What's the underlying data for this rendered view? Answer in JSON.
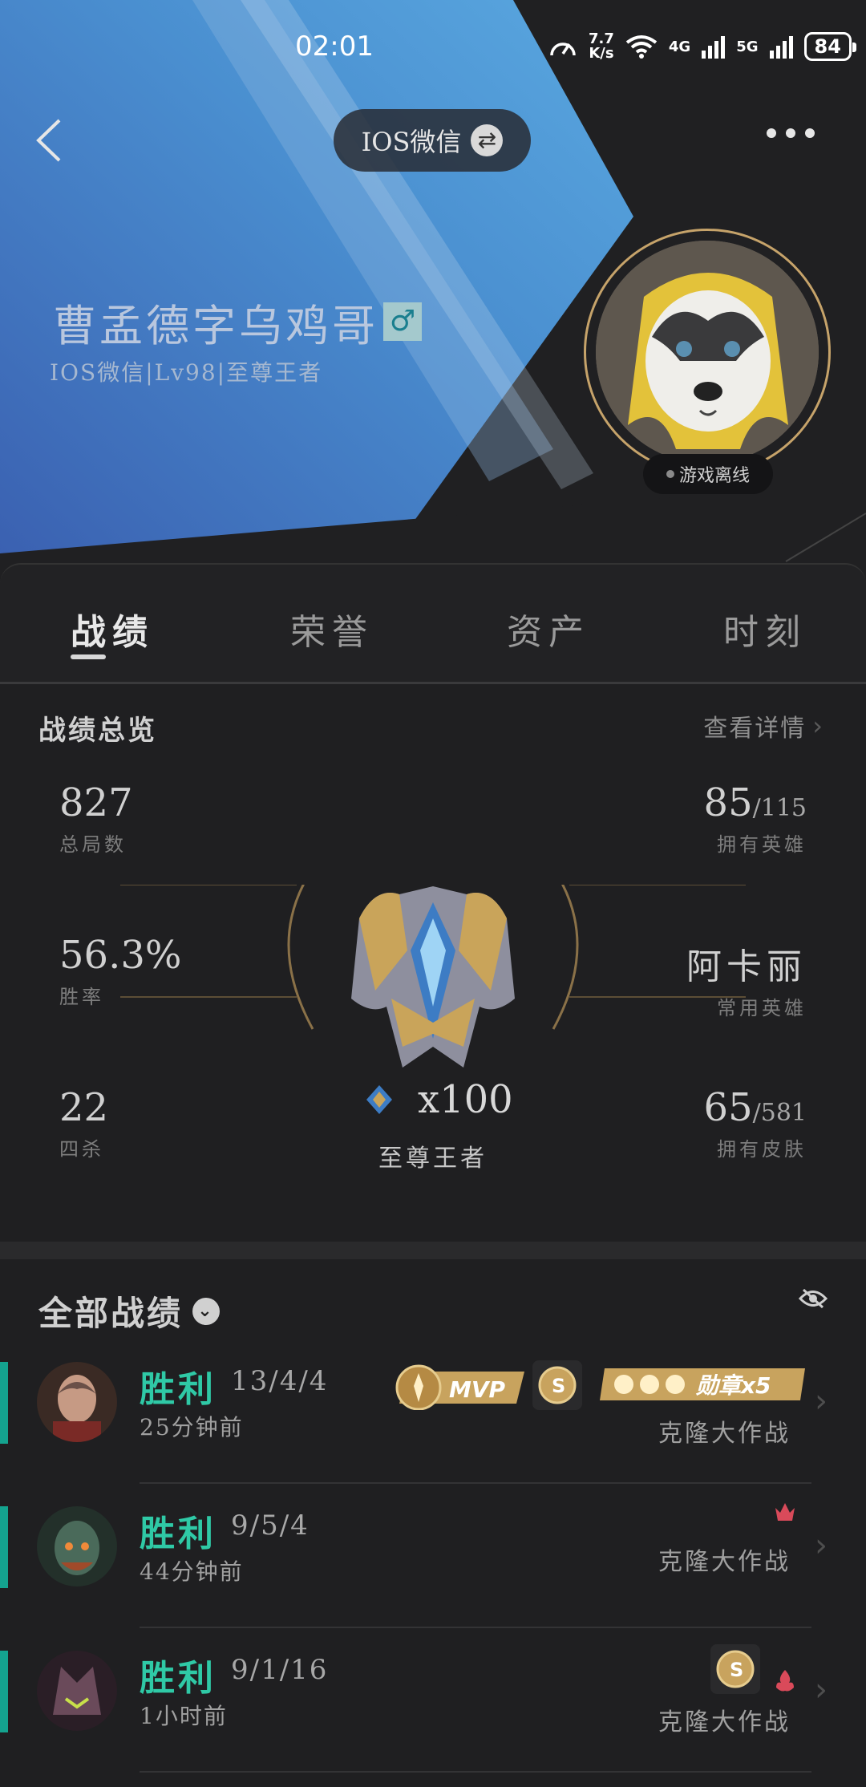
{
  "status_bar": {
    "time": "02:01",
    "speed_value": "7.7",
    "speed_unit": "K/s",
    "net1": "4G",
    "net2": "5G",
    "battery": "84"
  },
  "header": {
    "account": "IOS微信",
    "nickname": "曹孟德字乌鸡哥",
    "gender_symbol": "♂",
    "subinfo": "IOS微信|Lv98|至尊王者",
    "online_status": "游戏离线"
  },
  "tabs": [
    {
      "label": "战绩",
      "active": true
    },
    {
      "label": "荣誉",
      "active": false
    },
    {
      "label": "资产",
      "active": false
    },
    {
      "label": "时刻",
      "active": false
    }
  ],
  "overview": {
    "title": "战绩总览",
    "detail_link": "查看详情",
    "total_games": {
      "value": "827",
      "label": "总局数"
    },
    "heroes_owned": {
      "value": "85",
      "total": "/115",
      "label": "拥有英雄"
    },
    "win_rate": {
      "value": "56.3%",
      "label": "胜率"
    },
    "common_hero": {
      "value": "阿卡丽",
      "label": "常用英雄"
    },
    "quadra_kills": {
      "value": "22",
      "label": "四杀"
    },
    "skins_owned": {
      "value": "65",
      "total": "/581",
      "label": "拥有皮肤"
    },
    "rank_multiplier": "x100",
    "rank_name": "至尊王者"
  },
  "matches": {
    "title": "全部战绩",
    "items": [
      {
        "result": "胜利",
        "kda": "13/4/4",
        "time": "25分钟前",
        "mode": "克隆大作战",
        "mvp": "MVP",
        "medals": "勋章x5"
      },
      {
        "result": "胜利",
        "kda": "9/5/4",
        "time": "44分钟前",
        "mode": "克隆大作战"
      },
      {
        "result": "胜利",
        "kda": "9/1/16",
        "time": "1小时前",
        "mode": "克隆大作战"
      }
    ]
  },
  "colors": {
    "win": "#2fc9a6",
    "win_bar": "#14a38f",
    "gold": "#c6a36a",
    "header_blue": "#4a8fd0"
  }
}
